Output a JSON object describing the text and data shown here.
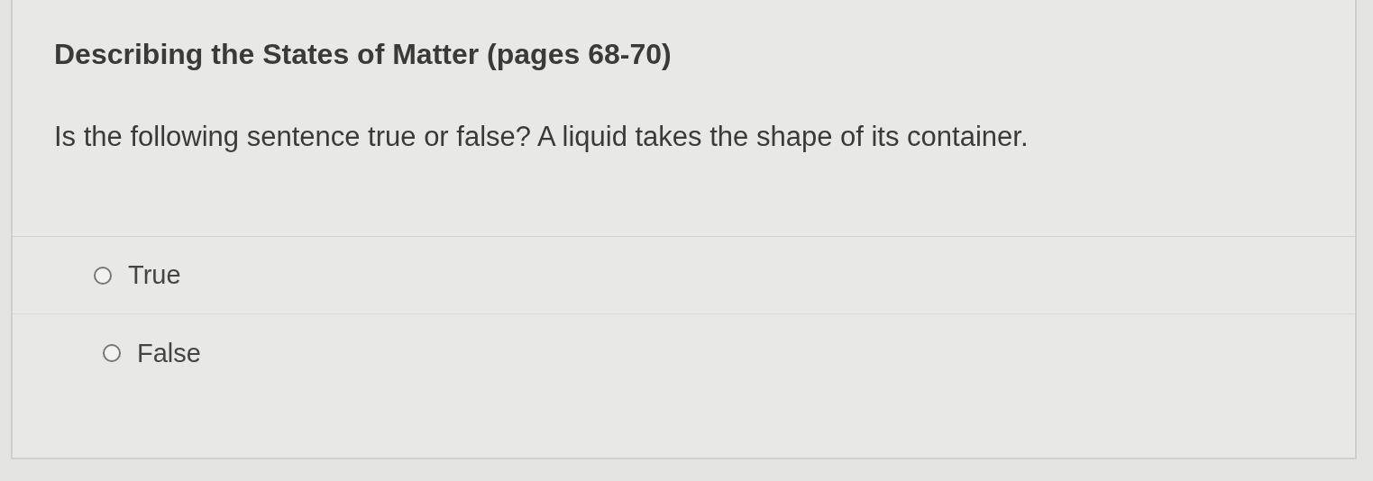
{
  "title": "Describing the States of Matter (pages 68-70)",
  "question": "Is the following sentence true or false? A liquid takes the shape of its container.",
  "options": [
    {
      "label": "True",
      "selected": false
    },
    {
      "label": "False",
      "selected": false
    }
  ]
}
